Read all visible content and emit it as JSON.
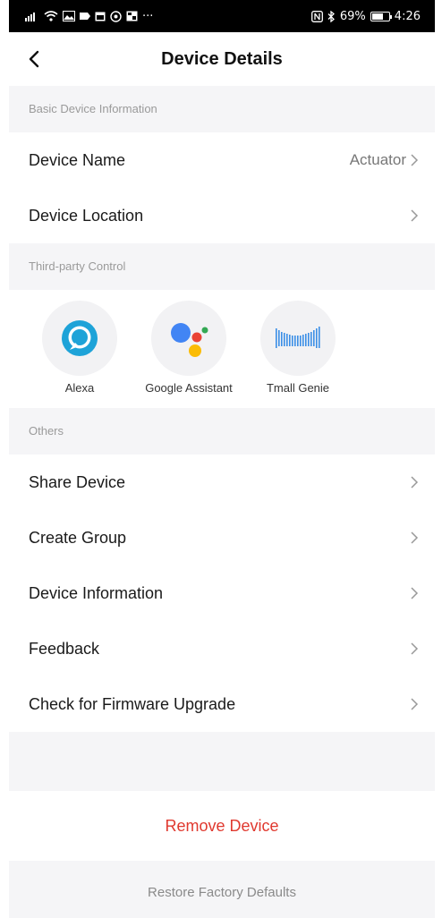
{
  "status_bar": {
    "battery": "69%",
    "time": "4:26",
    "battery_level": 0.69
  },
  "header": {
    "title": "Device Details"
  },
  "sections": {
    "basic": {
      "title": "Basic Device Information",
      "device_name": {
        "label": "Device Name",
        "value": "Actuator"
      },
      "device_location": {
        "label": "Device Location"
      }
    },
    "third_party": {
      "title": "Third-party Control",
      "alexa": {
        "label": "Alexa",
        "icon": "alexa-icon",
        "color": "#1ea3d8"
      },
      "google": {
        "label": "Google Assistant",
        "icon": "google-assistant-icon"
      },
      "tmall": {
        "label": "Tmall Genie",
        "icon": "tmall-genie-icon",
        "color": "#3b8fe6"
      }
    },
    "others": {
      "title": "Others",
      "share": "Share Device",
      "group": "Create Group",
      "info": "Device Information",
      "feedback": "Feedback",
      "firmware": "Check for Firmware Upgrade"
    }
  },
  "actions": {
    "remove": "Remove Device",
    "restore": "Restore Factory Defaults"
  },
  "colors": {
    "remove": "#e0392f",
    "google_blue": "#4285f4",
    "google_red": "#ea4335",
    "google_yellow": "#fbbc05",
    "google_green": "#34a853"
  }
}
